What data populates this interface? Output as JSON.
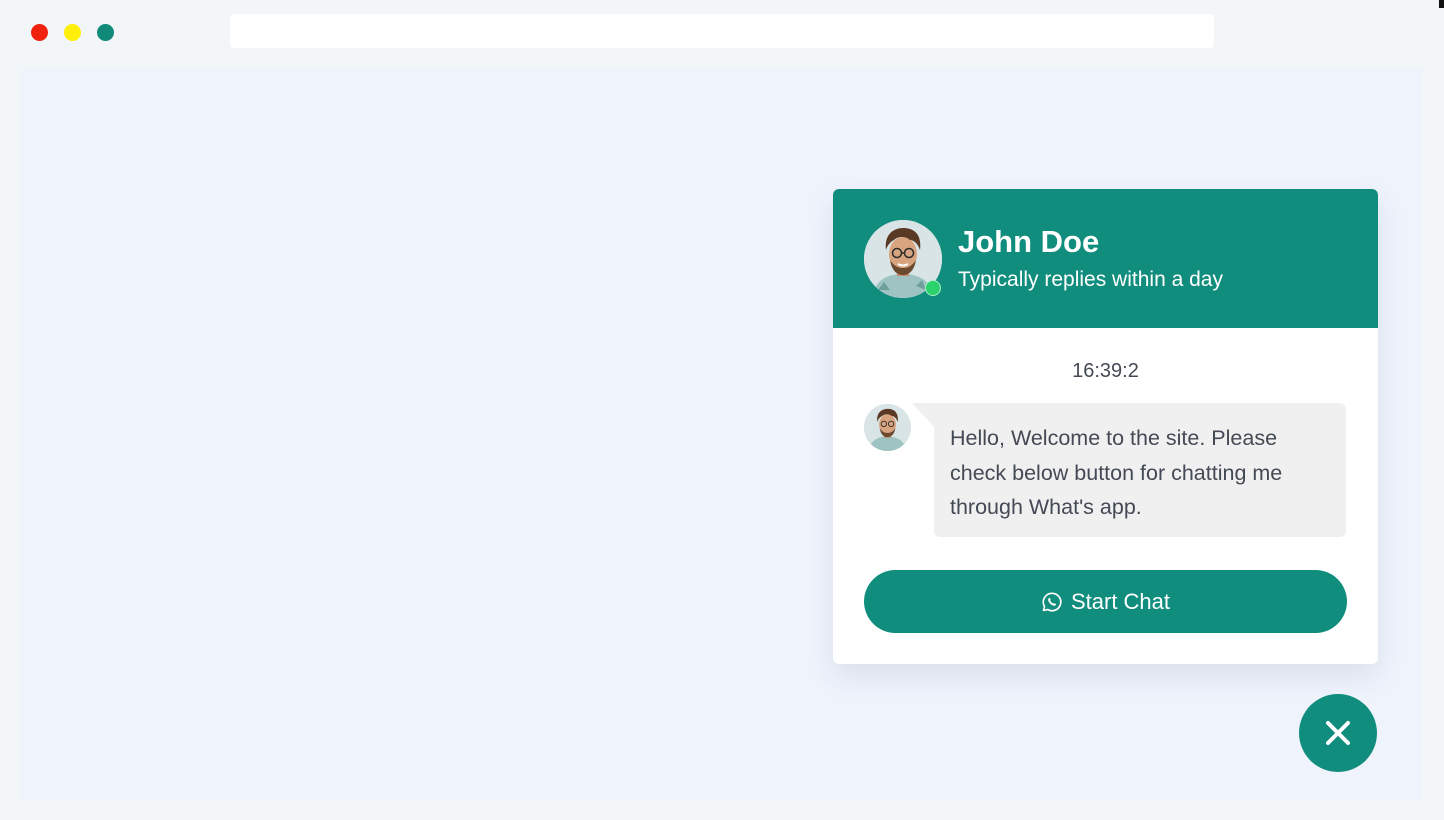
{
  "browser": {
    "traffic_lights": [
      "#f0220f",
      "#ffef0a",
      "#118a7a"
    ]
  },
  "chat": {
    "accent_color": "#118d7e",
    "online_color": "#2bd16b",
    "agent": {
      "name": "John Doe",
      "status": "Typically replies within a day",
      "avatar_icon": "profile-photo"
    },
    "timestamp": "16:39:2",
    "message": "Hello, Welcome to the site. Please check below button for chatting me through What's app.",
    "start_button": {
      "label": "Start Chat",
      "icon": "whatsapp-icon"
    }
  },
  "fab": {
    "icon": "close-icon"
  }
}
